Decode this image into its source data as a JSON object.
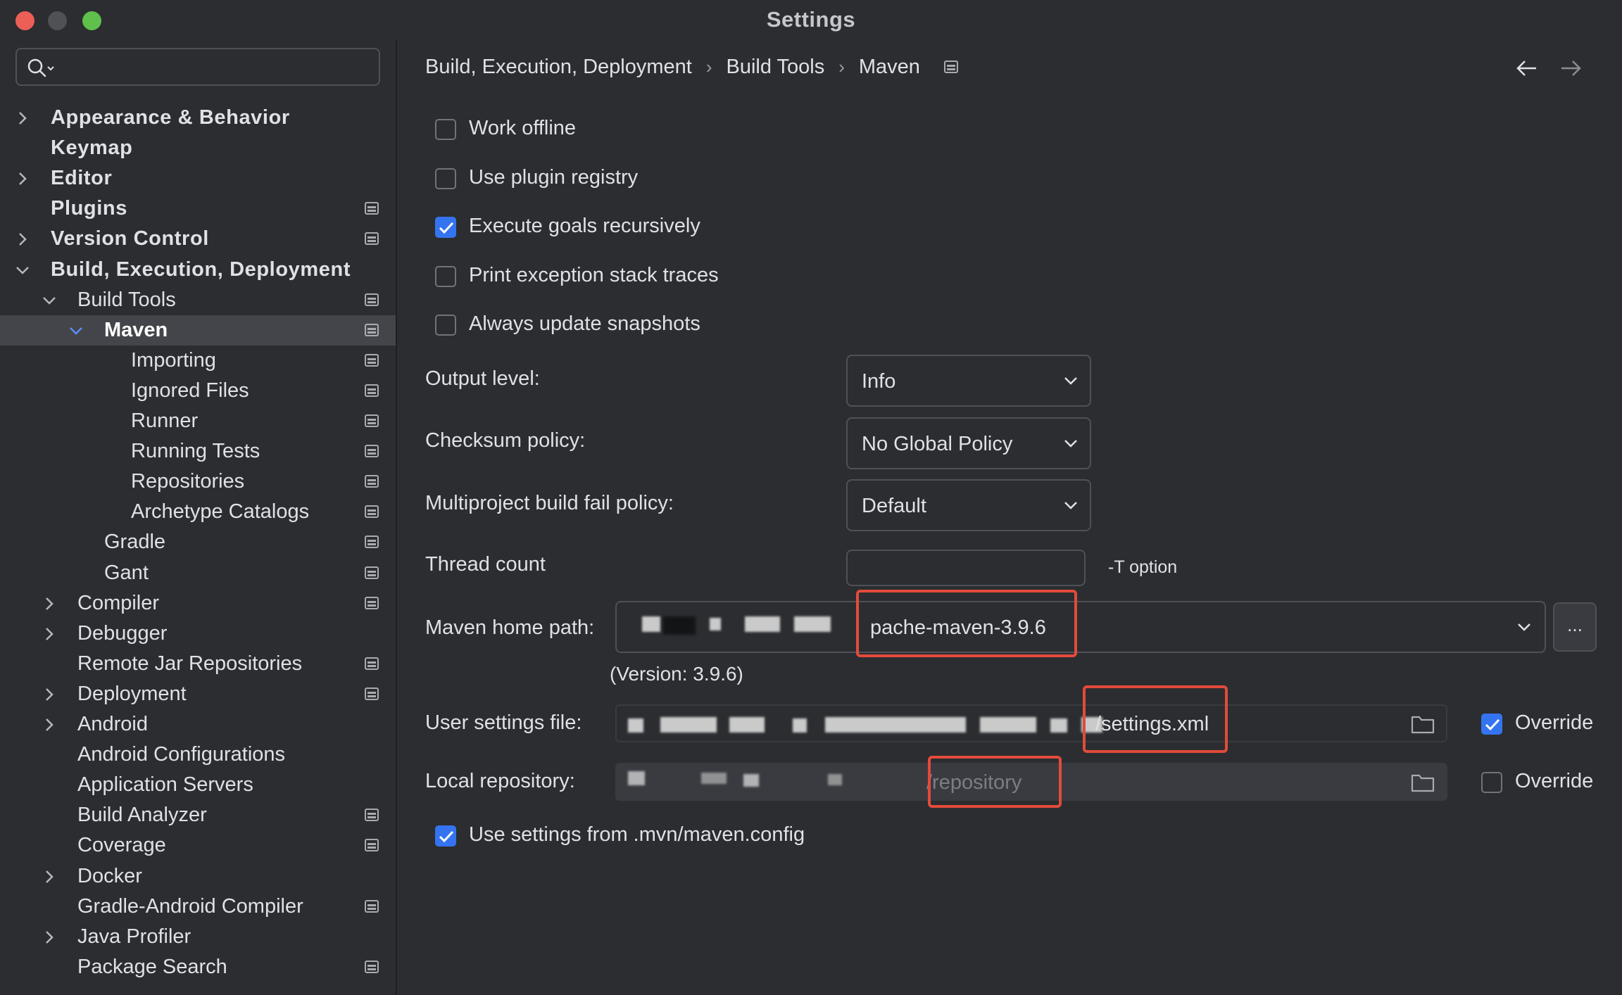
{
  "window": {
    "title": "Settings"
  },
  "search": {
    "placeholder": ""
  },
  "sidebar": {
    "items": [
      {
        "label": "Appearance & Behavior",
        "level": 0,
        "expandable": true,
        "expanded": false,
        "bold": true,
        "project": false
      },
      {
        "label": "Keymap",
        "level": 0,
        "expandable": false,
        "bold": true,
        "project": false
      },
      {
        "label": "Editor",
        "level": 0,
        "expandable": true,
        "expanded": false,
        "bold": true,
        "project": false
      },
      {
        "label": "Plugins",
        "level": 0,
        "expandable": false,
        "bold": true,
        "project": true
      },
      {
        "label": "Version Control",
        "level": 0,
        "expandable": true,
        "expanded": false,
        "bold": true,
        "project": true
      },
      {
        "label": "Build, Execution, Deployment",
        "level": 0,
        "expandable": true,
        "expanded": true,
        "bold": true,
        "project": false
      },
      {
        "label": "Build Tools",
        "level": 1,
        "expandable": true,
        "expanded": true,
        "bold": false,
        "project": true
      },
      {
        "label": "Maven",
        "level": 2,
        "expandable": true,
        "expanded": true,
        "bold": false,
        "project": true,
        "selected": true
      },
      {
        "label": "Importing",
        "level": 3,
        "expandable": false,
        "bold": false,
        "project": true
      },
      {
        "label": "Ignored Files",
        "level": 3,
        "expandable": false,
        "bold": false,
        "project": true
      },
      {
        "label": "Runner",
        "level": 3,
        "expandable": false,
        "bold": false,
        "project": true
      },
      {
        "label": "Running Tests",
        "level": 3,
        "expandable": false,
        "bold": false,
        "project": true
      },
      {
        "label": "Repositories",
        "level": 3,
        "expandable": false,
        "bold": false,
        "project": true
      },
      {
        "label": "Archetype Catalogs",
        "level": 3,
        "expandable": false,
        "bold": false,
        "project": true
      },
      {
        "label": "Gradle",
        "level": 2,
        "expandable": false,
        "bold": false,
        "project": true
      },
      {
        "label": "Gant",
        "level": 2,
        "expandable": false,
        "bold": false,
        "project": true
      },
      {
        "label": "Compiler",
        "level": 1,
        "expandable": true,
        "expanded": false,
        "bold": false,
        "project": true
      },
      {
        "label": "Debugger",
        "level": 1,
        "expandable": true,
        "expanded": false,
        "bold": false,
        "project": false
      },
      {
        "label": "Remote Jar Repositories",
        "level": 1,
        "expandable": false,
        "bold": false,
        "project": true
      },
      {
        "label": "Deployment",
        "level": 1,
        "expandable": true,
        "expanded": false,
        "bold": false,
        "project": true
      },
      {
        "label": "Android",
        "level": 1,
        "expandable": true,
        "expanded": false,
        "bold": false,
        "project": false
      },
      {
        "label": "Android Configurations",
        "level": 1,
        "expandable": false,
        "bold": false,
        "project": false
      },
      {
        "label": "Application Servers",
        "level": 1,
        "expandable": false,
        "bold": false,
        "project": false
      },
      {
        "label": "Build Analyzer",
        "level": 1,
        "expandable": false,
        "bold": false,
        "project": true
      },
      {
        "label": "Coverage",
        "level": 1,
        "expandable": false,
        "bold": false,
        "project": true
      },
      {
        "label": "Docker",
        "level": 1,
        "expandable": true,
        "expanded": false,
        "bold": false,
        "project": false
      },
      {
        "label": "Gradle-Android Compiler",
        "level": 1,
        "expandable": false,
        "bold": false,
        "project": true
      },
      {
        "label": "Java Profiler",
        "level": 1,
        "expandable": true,
        "expanded": false,
        "bold": false,
        "project": false
      },
      {
        "label": "Package Search",
        "level": 1,
        "expandable": false,
        "bold": false,
        "project": true
      }
    ]
  },
  "breadcrumb": [
    "Build, Execution, Deployment",
    "Build Tools",
    "Maven"
  ],
  "options": {
    "work_offline": {
      "label": "Work offline",
      "checked": false
    },
    "plugin_registry": {
      "label": "Use plugin registry",
      "checked": false
    },
    "execute_recursive": {
      "label": "Execute goals recursively",
      "checked": true
    },
    "print_stack": {
      "label": "Print exception stack traces",
      "checked": false
    },
    "update_snapshots": {
      "label": "Always update snapshots",
      "checked": false
    }
  },
  "output_level": {
    "label": "Output level:",
    "value": "Info"
  },
  "checksum_policy": {
    "label": "Checksum policy:",
    "value": "No Global Policy"
  },
  "fail_policy": {
    "label": "Multiproject build fail policy:",
    "value": "Default"
  },
  "thread_count": {
    "label": "Thread count",
    "value": "",
    "hint": "-T option"
  },
  "maven_home": {
    "label": "Maven home path:",
    "value": "pache-maven-3.9.6",
    "browse": "...",
    "version": "(Version: 3.9.6)"
  },
  "user_settings": {
    "label": "User settings file:",
    "value": "/settings.xml",
    "override_label": "Override",
    "override": true
  },
  "local_repo": {
    "label": "Local repository:",
    "value": "/repository",
    "override_label": "Override",
    "override": false
  },
  "mvn_config": {
    "label": "Use settings from .mvn/maven.config",
    "checked": true
  },
  "colors": {
    "accent": "#3574f0",
    "highlight": "#e24b3b",
    "background": "#2b2d30"
  }
}
